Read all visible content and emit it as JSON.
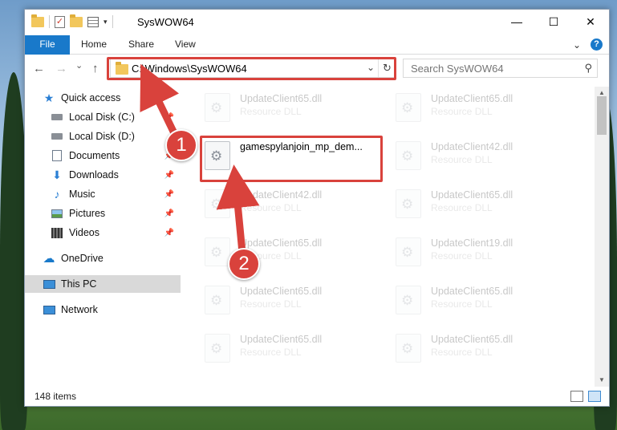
{
  "window": {
    "title": "SysWOW64",
    "minimize": "—",
    "maximize": "☐",
    "close": "✕"
  },
  "ribbon": {
    "tabs": [
      "File",
      "Home",
      "Share",
      "View"
    ],
    "help": "?"
  },
  "nav": {
    "back": "←",
    "forward": "→",
    "recent": "⌄",
    "up": "↑",
    "address": "C:\\Windows\\SysWOW64",
    "address_dropdown": "⌄",
    "refresh": "↻",
    "search_placeholder": "Search SysWOW64",
    "search_icon": "⚲"
  },
  "sidebar": {
    "items": [
      {
        "label": "Quick access",
        "icon": "star-icon",
        "pinned": false
      },
      {
        "label": "Local Disk (C:)",
        "icon": "drive-icon",
        "pinned": true
      },
      {
        "label": "Local Disk (D:)",
        "icon": "drive-icon",
        "pinned": false
      },
      {
        "label": "Documents",
        "icon": "documents-icon",
        "pinned": true
      },
      {
        "label": "Downloads",
        "icon": "download-icon",
        "pinned": true
      },
      {
        "label": "Music",
        "icon": "music-icon",
        "pinned": true
      },
      {
        "label": "Pictures",
        "icon": "pictures-icon",
        "pinned": true
      },
      {
        "label": "Videos",
        "icon": "videos-icon",
        "pinned": true
      },
      {
        "label": "OneDrive",
        "icon": "cloud-icon",
        "pinned": false
      },
      {
        "label": "This PC",
        "icon": "computer-icon",
        "pinned": false,
        "selected": true
      },
      {
        "label": "Network",
        "icon": "network-icon",
        "pinned": false
      }
    ]
  },
  "files": {
    "left": [
      {
        "name": "UpdateClient65.dll",
        "type": "Resource DLL"
      },
      {
        "name": "gamespylanjoin_mp_dem...",
        "type": ""
      },
      {
        "name": "UpdateClient42.dll",
        "type": "Resource DLL"
      },
      {
        "name": "UpdateClient65.dll",
        "type": "Resource DLL"
      },
      {
        "name": "UpdateClient65.dll",
        "type": "Resource DLL"
      },
      {
        "name": "UpdateClient65.dll",
        "type": "Resource DLL"
      }
    ],
    "right": [
      {
        "name": "UpdateClient65.dll",
        "type": "Resource DLL"
      },
      {
        "name": "UpdateClient42.dll",
        "type": "Resource DLL"
      },
      {
        "name": "UpdateClient65.dll",
        "type": "Resource DLL"
      },
      {
        "name": "UpdateClient19.dll",
        "type": "Resource DLL"
      },
      {
        "name": "UpdateClient65.dll",
        "type": "Resource DLL"
      },
      {
        "name": "UpdateClient65.dll",
        "type": "Resource DLL"
      }
    ]
  },
  "status": {
    "items_count": "148 items"
  },
  "annotations": {
    "badge1": "1",
    "badge2": "2",
    "color": "#d9423c"
  }
}
